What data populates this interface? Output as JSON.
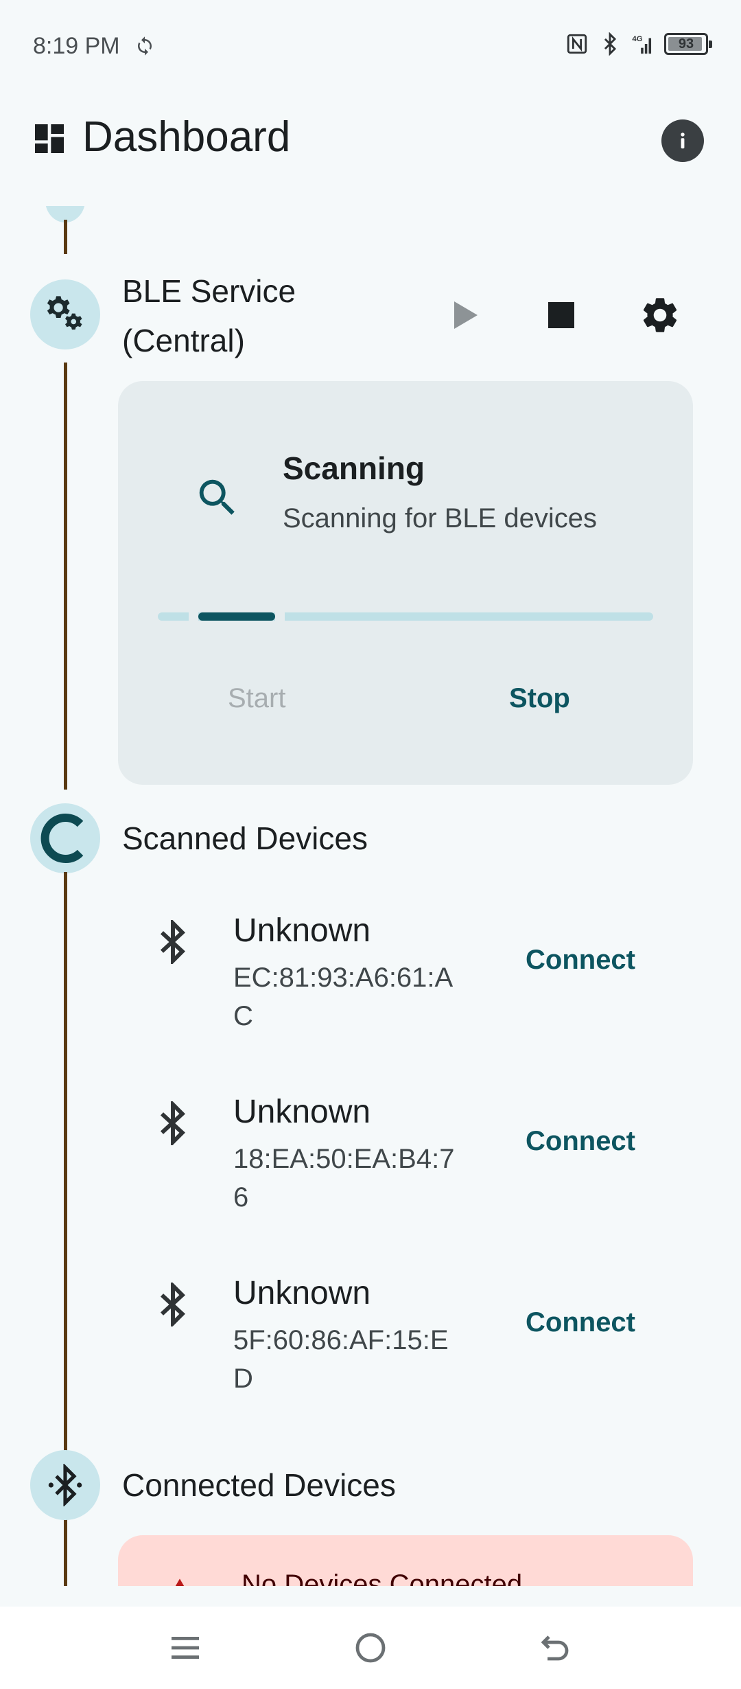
{
  "status_bar": {
    "time": "8:19 PM",
    "battery": "93"
  },
  "app_bar": {
    "title": "Dashboard",
    "icons": [
      "dashboard-icon",
      "info-icon"
    ]
  },
  "ble_service": {
    "title_line1": "BLE Service",
    "title_line2": "(Central)",
    "controls": [
      "play-icon",
      "stop-icon",
      "settings-icon"
    ]
  },
  "scan_card": {
    "title": "Scanning",
    "subtitle": "Scanning for BLE devices",
    "progress_fraction": 0.2,
    "start_label": "Start",
    "stop_label": "Stop"
  },
  "scanned_devices": {
    "title": "Scanned Devices",
    "devices": [
      {
        "name": "Unknown",
        "address": "EC:81:93:A6:61:AC",
        "action": "Connect"
      },
      {
        "name": "Unknown",
        "address": "18:EA:50:EA:B4:76",
        "action": "Connect"
      },
      {
        "name": "Unknown",
        "address": "5F:60:86:AF:15:ED",
        "action": "Connect"
      }
    ]
  },
  "connected_devices": {
    "title": "Connected Devices",
    "empty_text": "No Devices Connected"
  },
  "colors": {
    "accent": "#0d5560",
    "timeline": "#5a3a12",
    "node_bg": "#c9e6ec",
    "card_bg": "#e5ecee",
    "error_card_bg": "#ffdad6"
  }
}
